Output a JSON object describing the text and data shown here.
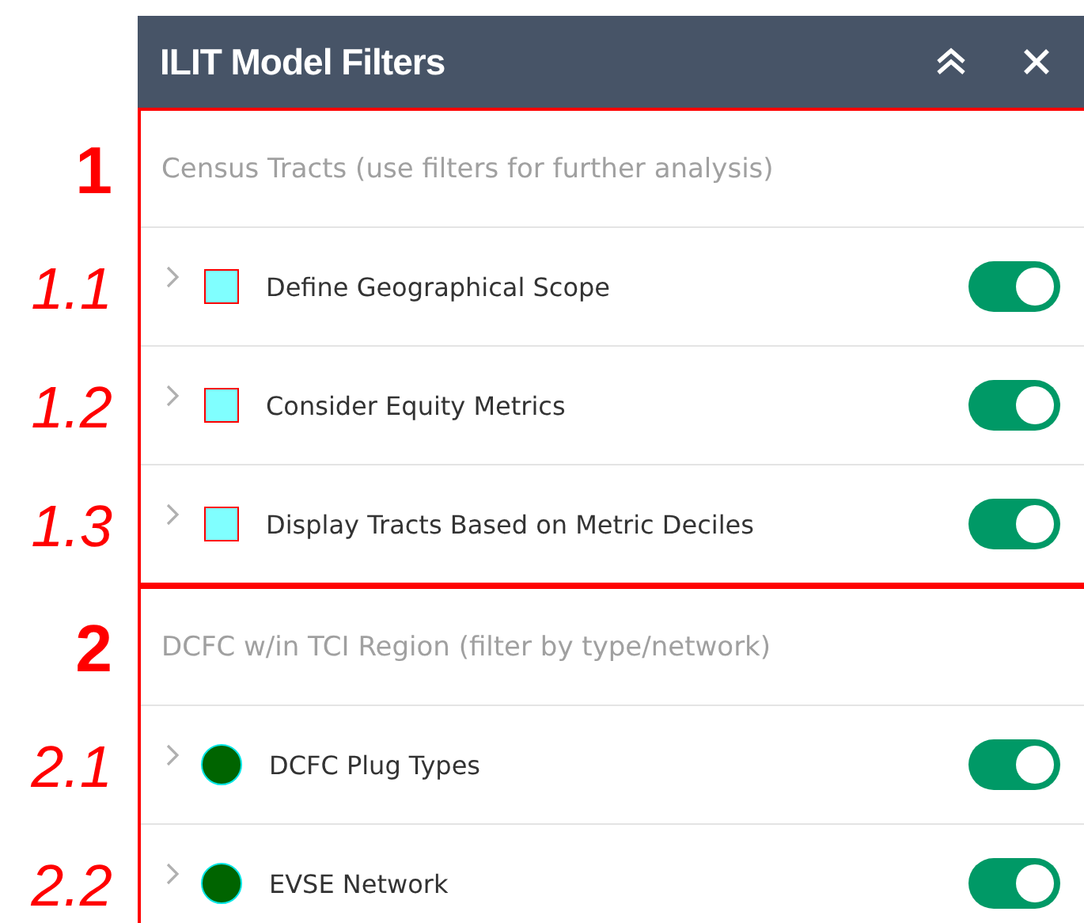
{
  "window": {
    "title": "ILIT Model Filters"
  },
  "sections": [
    {
      "number": "1",
      "heading": "Census Tracts (use filters for further analysis)",
      "layers": [
        {
          "number": "1.1",
          "label": "Define Geographical Scope",
          "kind": "square",
          "color": "#80ffff",
          "on": true
        },
        {
          "number": "1.2",
          "label": "Consider Equity Metrics",
          "kind": "square",
          "color": "#80ffff",
          "on": true
        },
        {
          "number": "1.3",
          "label": "Display Tracts Based on Metric Deciles",
          "kind": "square",
          "color": "#80ffff",
          "on": true
        }
      ]
    },
    {
      "number": "2",
      "heading": "DCFC w/in TCI Region (filter by type/network)",
      "layers": [
        {
          "number": "2.1",
          "label": "DCFC Plug Types",
          "kind": "circle",
          "color": "#006400",
          "on": true
        },
        {
          "number": "2.2",
          "label": "EVSE Network",
          "kind": "circle",
          "color": "#006400",
          "on": true
        }
      ]
    }
  ]
}
